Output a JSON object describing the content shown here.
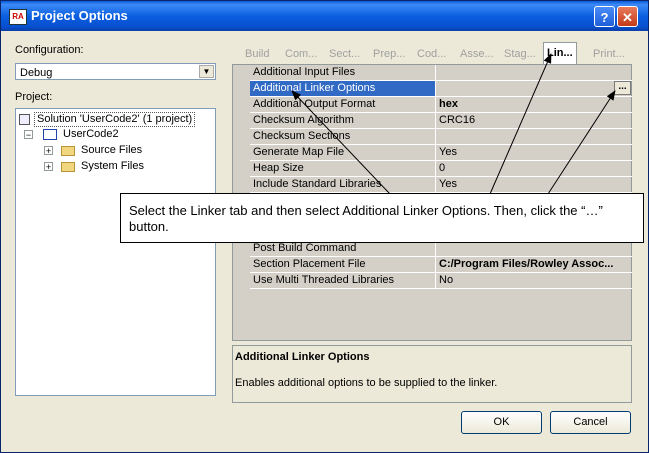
{
  "window": {
    "title": "Project Options",
    "app_icon_text": "RA",
    "help_label": "?",
    "close_label": "✕"
  },
  "left": {
    "config_label": "Configuration:",
    "config_value": "Debug",
    "project_label": "Project:",
    "tree": {
      "solution": "Solution 'UserCode2' (1 project)",
      "project": "UserCode2",
      "folders": [
        "Source Files",
        "System Files"
      ]
    }
  },
  "tabs": [
    "Build",
    "Com...",
    "Sect...",
    "Prep...",
    "Cod...",
    "Asse...",
    "Stag...",
    "Lin...",
    "Print..."
  ],
  "active_tab": "Lin...",
  "properties": [
    {
      "name": "Additional Input Files",
      "value": ""
    },
    {
      "name": "Additional Linker Options",
      "value": "",
      "selected": true
    },
    {
      "name": "Additional Output Format",
      "value": "hex",
      "bold": true
    },
    {
      "name": "Checksum Algorithm",
      "value": "CRC16"
    },
    {
      "name": "Checksum Sections",
      "value": ""
    },
    {
      "name": "Generate Map File",
      "value": "Yes"
    },
    {
      "name": "Heap Size",
      "value": "0"
    },
    {
      "name": "Include Standard Libraries",
      "value": "Yes"
    },
    {
      "name": "Post Build Command",
      "value": ""
    },
    {
      "name": "Section Placement File",
      "value": "C:/Program Files/Rowley Assoc...",
      "bold": true
    },
    {
      "name": "Use Multi Threaded Libraries",
      "value": "No"
    }
  ],
  "ellipsis_label": "...",
  "description": {
    "title": "Additional Linker Options",
    "text": "Enables additional options to be supplied to the linker."
  },
  "buttons": {
    "ok": "OK",
    "cancel": "Cancel"
  },
  "callout": "Select the Linker tab and then select Additional Linker Options. Then, click the “…” button."
}
